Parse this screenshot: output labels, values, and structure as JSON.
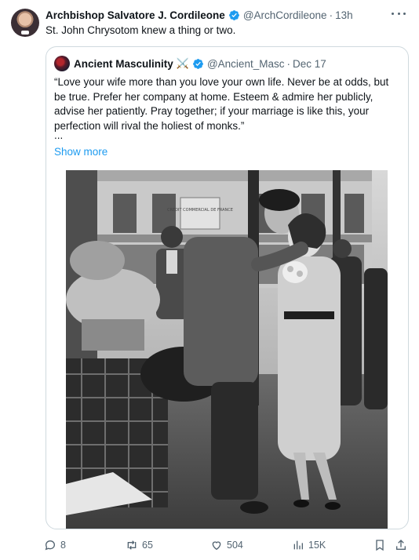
{
  "author": {
    "name": "Archbishop Salvatore J. Cordileone",
    "handle": "@ArchCordileone",
    "separator": "·",
    "time": "13h"
  },
  "tweet_text": "St. John Chrysotom knew a thing or two.",
  "quoted": {
    "name": "Ancient Masculinity",
    "emoji": "⚔️",
    "handle": "@Ancient_Masc",
    "separator": "·",
    "date": "Dec 17",
    "text": "“Love your wife more than you love your own life. Never be at odds, but be true. Prefer her company at home. Esteem & admire her publicly, advise her patiently. Pray together; if your marriage is like this, your perfection will rival the holiest of monks.”",
    "ellipsis": "...",
    "show_more": "Show more",
    "image_sign": "CREDIT COMMERCIAL DE FRANCE"
  },
  "actions": {
    "replies": "8",
    "reposts": "65",
    "likes": "504",
    "views": "15K"
  },
  "colors": {
    "accent": "#1d9bf0",
    "text": "#0f1419",
    "muted": "#536471",
    "border": "#cfd9de"
  },
  "icons": [
    "more-icon",
    "verified-icon",
    "crossed-swords-emoji",
    "reply-icon",
    "repost-icon",
    "like-icon",
    "views-icon",
    "bookmark-icon",
    "share-icon"
  ]
}
